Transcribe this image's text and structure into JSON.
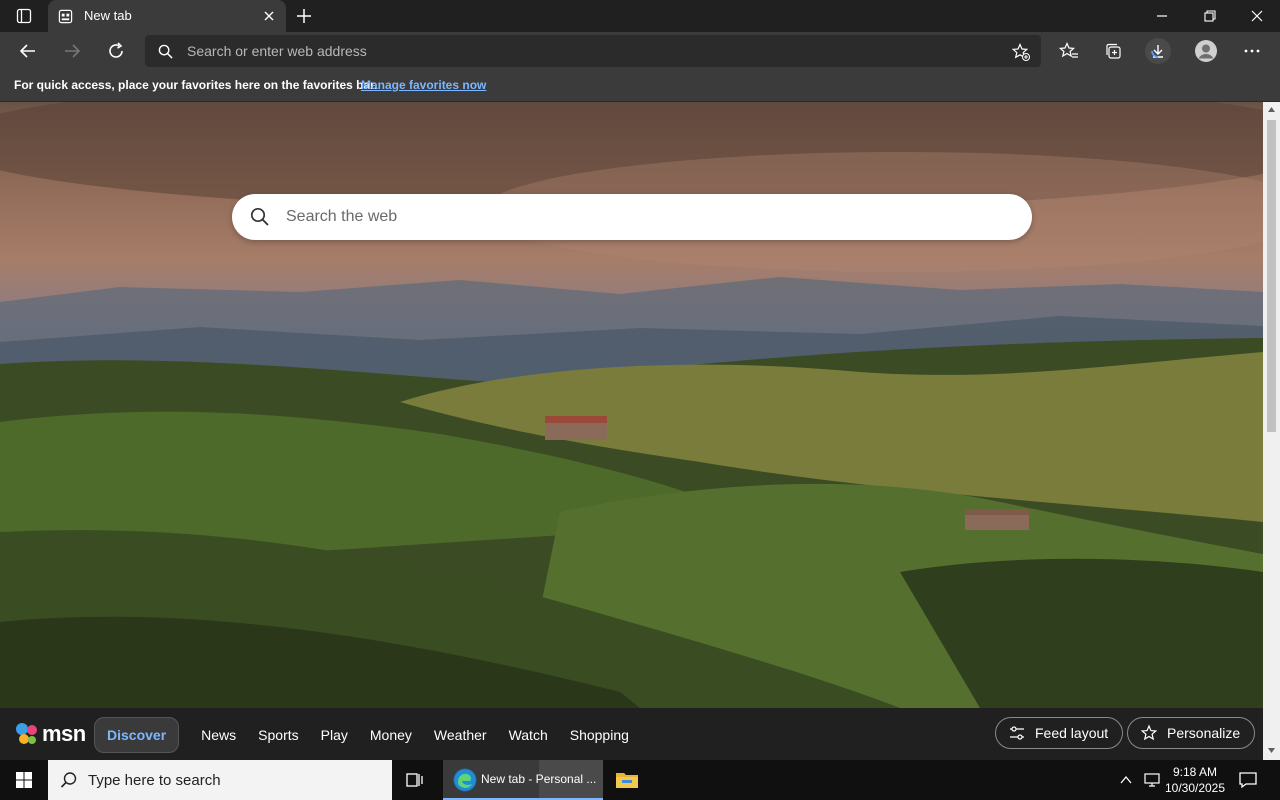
{
  "browser": {
    "tab": {
      "title": "New tab"
    },
    "address_bar": {
      "placeholder": "Search or enter web address"
    },
    "favorites_bar": {
      "message": "For quick access, place your favorites here on the favorites bar.",
      "link": "Manage favorites now"
    }
  },
  "page": {
    "search": {
      "placeholder": "Search the web"
    },
    "msn": {
      "logo": "msn",
      "nav": [
        "Discover",
        "News",
        "Sports",
        "Play",
        "Money",
        "Weather",
        "Watch",
        "Shopping"
      ],
      "feed_layout_label": "Feed layout",
      "personalize_label": "Personalize"
    }
  },
  "taskbar": {
    "search_placeholder": "Type here to search",
    "edge_task_label": "New tab - Personal ...",
    "clock": {
      "time": "9:18 AM",
      "date": "10/30/2025"
    }
  },
  "colors": {
    "accent_link": "#7cb7ff",
    "chrome_dark": "#202020",
    "toolbar": "#3b3b3b"
  }
}
